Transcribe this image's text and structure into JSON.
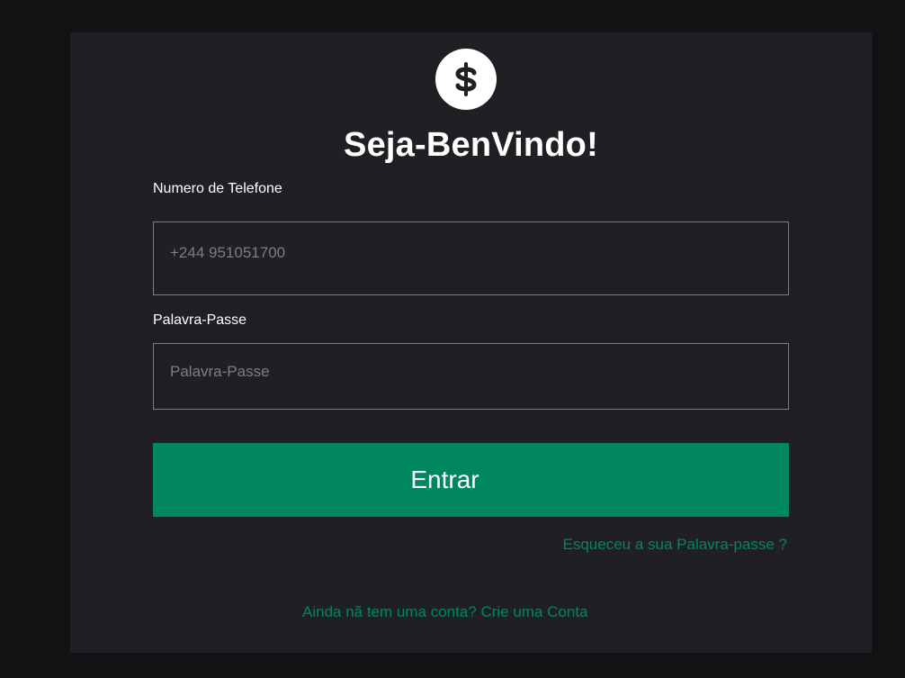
{
  "header": {
    "logo_icon": "dollar-sign-icon",
    "title": "Seja-BenVindo!"
  },
  "form": {
    "phone": {
      "label": "Numero de Telefone",
      "placeholder": "+244 951051700",
      "value": ""
    },
    "password": {
      "label": "Palavra-Passe",
      "placeholder": "Palavra-Passe",
      "value": ""
    },
    "submit_label": "Entrar"
  },
  "links": {
    "forgot_password": "Esqueceu a sua Palavra-passe ?",
    "signup": "Ainda nã tem uma conta? Crie uma Conta"
  },
  "colors": {
    "background": "#121214",
    "card": "#202024",
    "accent": "#00875f",
    "border": "#7c7c8a",
    "text": "#ffffff"
  }
}
